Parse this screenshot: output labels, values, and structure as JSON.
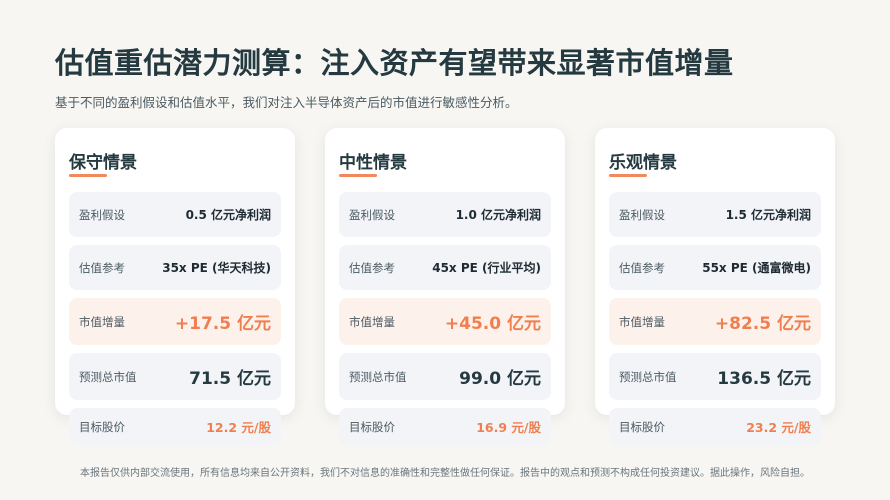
{
  "title": "估值重估潜力测算：注入资产有望带来显著市值增量",
  "subtitle": "基于不同的盈利假设和估值水平，我们对注入半导体资产后的市值进行敏感性分析。",
  "scenarios": [
    {
      "name": "保守情景",
      "rows": [
        {
          "label": "盈利假设",
          "value": "0.5 亿元净利润"
        },
        {
          "label": "估值参考",
          "value": "35x PE (华天科技)"
        },
        {
          "label": "市值增量",
          "value": "+17.5 亿元"
        },
        {
          "label": "预测总市值",
          "value": "71.5 亿元"
        },
        {
          "label": "目标股价",
          "value": "12.2 元/股"
        }
      ]
    },
    {
      "name": "中性情景",
      "rows": [
        {
          "label": "盈利假设",
          "value": "1.0 亿元净利润"
        },
        {
          "label": "估值参考",
          "value": "45x PE (行业平均)"
        },
        {
          "label": "市值增量",
          "value": "+45.0 亿元"
        },
        {
          "label": "预测总市值",
          "value": "99.0 亿元"
        },
        {
          "label": "目标股价",
          "value": "16.9 元/股"
        }
      ]
    },
    {
      "name": "乐观情景",
      "rows": [
        {
          "label": "盈利假设",
          "value": "1.5 亿元净利润"
        },
        {
          "label": "估值参考",
          "value": "55x PE (通富微电)"
        },
        {
          "label": "市值增量",
          "value": "+82.5 亿元"
        },
        {
          "label": "预测总市值",
          "value": "136.5 亿元"
        },
        {
          "label": "目标股价",
          "value": "23.2 元/股"
        }
      ]
    }
  ],
  "footer": "本报告仅供内部交流使用，所有信息均来自公开资料，我们不对信息的准确性和完整性做任何保证。报告中的观点和预测不构成任何投资建议。据此操作，风险自担。",
  "colors": {
    "accent": "#f07f50",
    "title": "#253a40",
    "background": "#f7f6f2"
  }
}
